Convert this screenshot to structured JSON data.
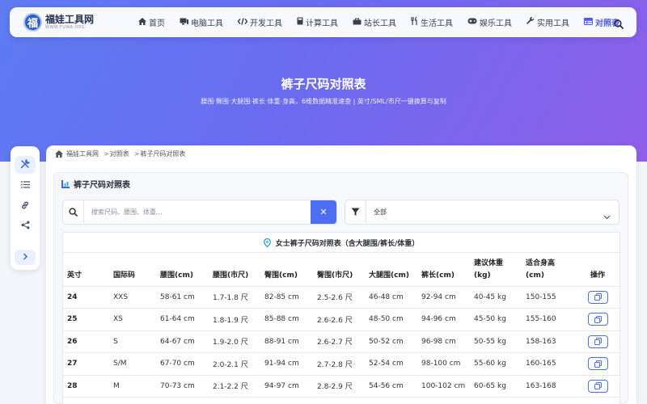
{
  "brand": {
    "name": "福娃工具网",
    "subtitle": "WWW.FUWA.ORG",
    "logo_char": "福"
  },
  "nav": {
    "items": [
      {
        "label": "首页",
        "icon": "home-icon"
      },
      {
        "label": "电脑工具",
        "icon": "desktop-icon"
      },
      {
        "label": "开发工具",
        "icon": "code-icon"
      },
      {
        "label": "计算工具",
        "icon": "calculator-icon"
      },
      {
        "label": "站长工具",
        "icon": "toolbox-icon"
      },
      {
        "label": "生活工具",
        "icon": "utensils-icon"
      },
      {
        "label": "娱乐工具",
        "icon": "gamepad-icon"
      },
      {
        "label": "实用工具",
        "icon": "wrench-icon"
      },
      {
        "label": "对照表",
        "icon": "table-icon",
        "active": true
      }
    ]
  },
  "hero": {
    "title": "裤子尺码对照表",
    "subtitle": "腰围·臀围·大腿围·裤长·体重·身高，6维数据精准速查 | 英寸/SML/市尺一键换算与复制"
  },
  "breadcrumb": [
    "福娃工具网",
    "对照表",
    "裤子尺码对照表"
  ],
  "card": {
    "title": "裤子尺码对照表"
  },
  "search": {
    "placeholder": "搜索尺码、腰围、体重...",
    "value": "",
    "clear_label": "✕"
  },
  "filter": {
    "selected": "全部"
  },
  "table": {
    "caption": "女士裤子尺码对照表（含大腿围/裤长/体重）",
    "headers": [
      "英寸",
      "国际码",
      "腰围(cm)",
      "腰围(市尺)",
      "臀围(cm)",
      "臀围(市尺)",
      "大腿围(cm)",
      "裤长(cm)",
      "建议体重 (kg)",
      "适合身高 (cm)",
      "操作"
    ],
    "rows": [
      [
        "24",
        "XXS",
        "58-61 cm",
        "1.7-1.8 尺",
        "82-85 cm",
        "2.5-2.6 尺",
        "46-48 cm",
        "92-94 cm",
        "40-45 kg",
        "150-155"
      ],
      [
        "25",
        "XS",
        "61-64 cm",
        "1.8-1.9 尺",
        "85-88 cm",
        "2.6-2.6 尺",
        "48-50 cm",
        "94-96 cm",
        "45-50 kg",
        "155-160"
      ],
      [
        "26",
        "S",
        "64-67 cm",
        "1.9-2.0 尺",
        "88-91 cm",
        "2.6-2.7 尺",
        "50-52 cm",
        "96-98 cm",
        "50-55 kg",
        "158-163"
      ],
      [
        "27",
        "S/M",
        "67-70 cm",
        "2.0-2.1 尺",
        "91-94 cm",
        "2.7-2.8 尺",
        "52-54 cm",
        "98-100 cm",
        "55-60 kg",
        "160-165"
      ],
      [
        "28",
        "M",
        "70-73 cm",
        "2.1-2.2 尺",
        "94-97 cm",
        "2.8-2.9 尺",
        "54-56 cm",
        "100-102 cm",
        "60-65 kg",
        "163-168"
      ]
    ]
  },
  "colors": {
    "accent": "#4c6ef5",
    "hero_start": "#5d7cf2",
    "hero_end": "#8f5ee8"
  }
}
